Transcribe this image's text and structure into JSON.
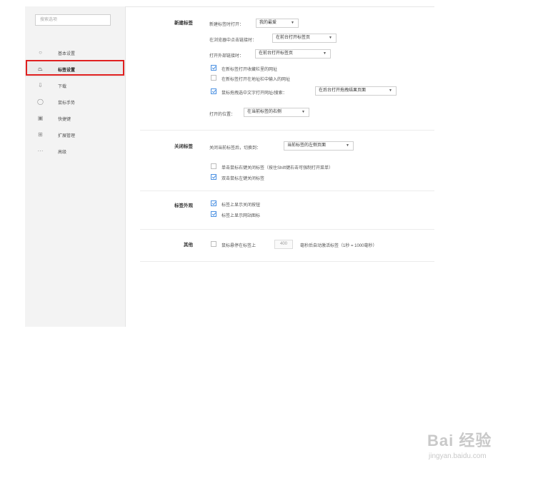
{
  "sidebar": {
    "search_placeholder": "搜索选项",
    "items": [
      {
        "label": "基本设置",
        "icon": "circle-icon"
      },
      {
        "label": "标签设置",
        "icon": "tab-icon"
      },
      {
        "label": "下载",
        "icon": "download-icon"
      },
      {
        "label": "鼠标手势",
        "icon": "mouse-icon"
      },
      {
        "label": "快捷键",
        "icon": "keyboard-icon"
      },
      {
        "label": "扩展管理",
        "icon": "grid-icon"
      },
      {
        "label": "高级",
        "icon": "more-icon"
      }
    ]
  },
  "new_tab": {
    "title": "新建标签",
    "open_label": "新建标签时打开：",
    "open_value": "我的最爱",
    "click_label": "在浏览器中点击链接时：",
    "click_value": "在前台打开标签页",
    "external_label": "打开外部链接时：",
    "external_value": "在前台打开标签页",
    "opt1": "在新标签打开收藏栏里的网址",
    "opt2": "在新标签打开在地址栏中输入的网址",
    "opt3": "鼠标拖拽选中文字打开网址/搜索：",
    "opt3_value": "在后台打开拖拽结果页面",
    "position_label": "打开的位置：",
    "position_value": "在当前标签的右侧"
  },
  "close_tab": {
    "title": "关闭标签",
    "switch_label": "关闭当前标签后，切换到：",
    "switch_value": "当前标签的左侧页面",
    "opt1": "单击鼠标右键关闭标签（按住Shift键右击可强制打开菜单）",
    "opt2": "双击鼠标左键关闭标签"
  },
  "tab_appearance": {
    "title": "标签外观",
    "opt1": "标签上显示关闭按钮",
    "opt2": "标签上显示网站图标"
  },
  "other": {
    "title": "其他",
    "hover_label": "鼠标悬停在标签上",
    "hover_value": "400",
    "hover_suffix": "毫秒后自动激活标签（1秒 = 1000毫秒）"
  },
  "watermark": {
    "brand": "Bai 经验",
    "url": "jingyan.baidu.com"
  },
  "colors": {
    "highlight": "#e02020",
    "check": "#4a90e2"
  }
}
